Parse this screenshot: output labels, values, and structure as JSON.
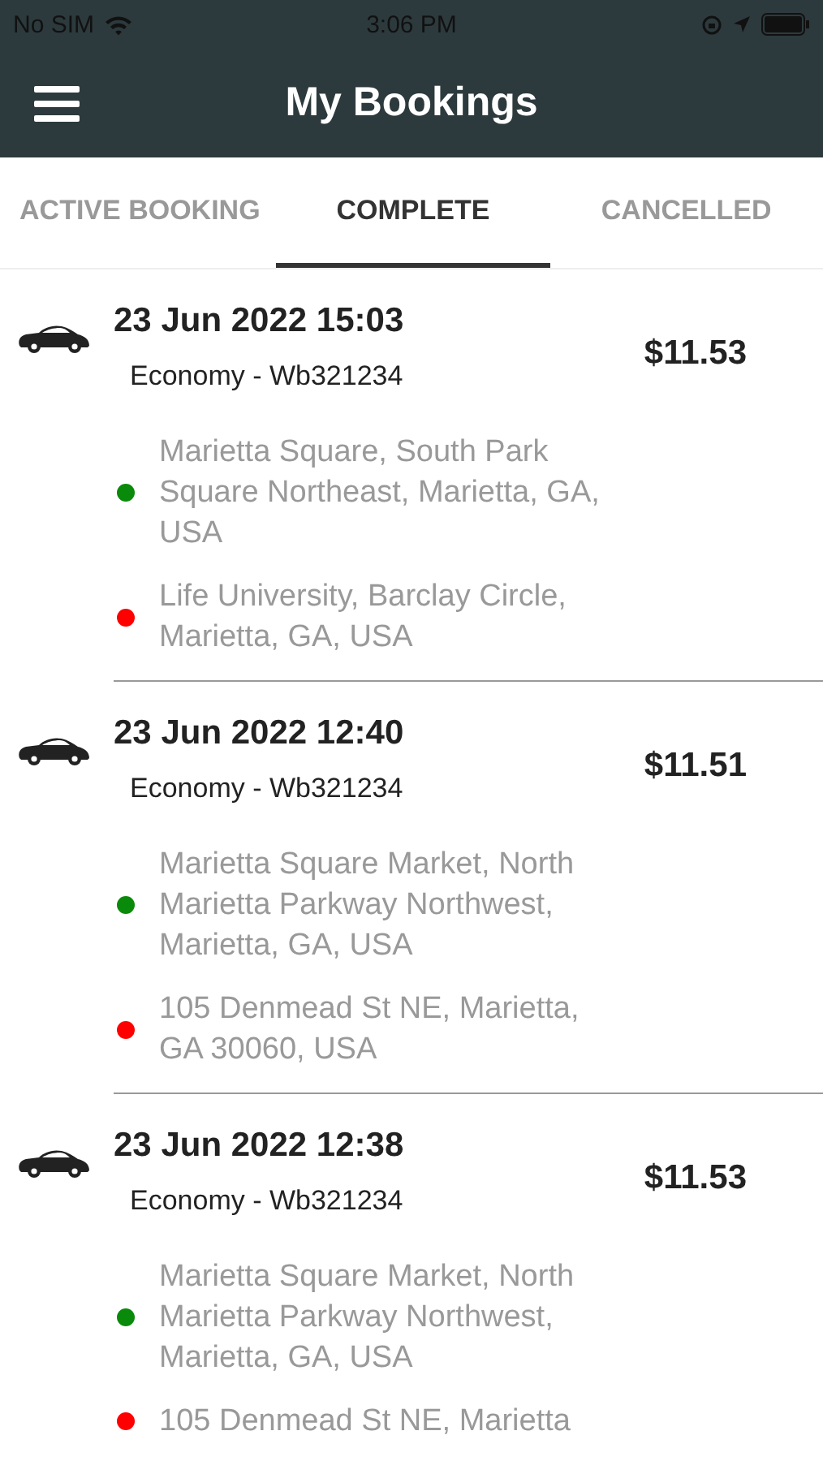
{
  "status_bar": {
    "carrier": "No SIM",
    "time": "3:06 PM"
  },
  "header": {
    "title": "My Bookings"
  },
  "tabs": [
    {
      "label": "ACTIVE BOOKING",
      "selected": false
    },
    {
      "label": "COMPLETE",
      "selected": true
    },
    {
      "label": "CANCELLED",
      "selected": false
    }
  ],
  "bookings": [
    {
      "datetime": "23 Jun 2022 15:03",
      "vehicle": "Economy - Wb321234",
      "price": "$11.53",
      "stops": [
        {
          "color": "#0a8a0a",
          "address": "Marietta Square, South Park Square Northeast, Marietta, GA, USA"
        },
        {
          "color": "#ff0000",
          "address": "Life University, Barclay Circle, Marietta, GA, USA"
        }
      ]
    },
    {
      "datetime": "23 Jun 2022 12:40",
      "vehicle": "Economy - Wb321234",
      "price": "$11.51",
      "stops": [
        {
          "color": "#0a8a0a",
          "address": "Marietta Square Market, North Marietta Parkway Northwest, Marietta, GA, USA"
        },
        {
          "color": "#ff0000",
          "address": "105 Denmead St NE, Marietta, GA 30060, USA"
        }
      ]
    },
    {
      "datetime": "23 Jun 2022 12:38",
      "vehicle": "Economy - Wb321234",
      "price": "$11.53",
      "stops": [
        {
          "color": "#0a8a0a",
          "address": "Marietta Square Market, North Marietta Parkway Northwest, Marietta, GA, USA"
        },
        {
          "color": "#ff0000",
          "address": "105 Denmead St NE, Marietta"
        }
      ]
    }
  ]
}
